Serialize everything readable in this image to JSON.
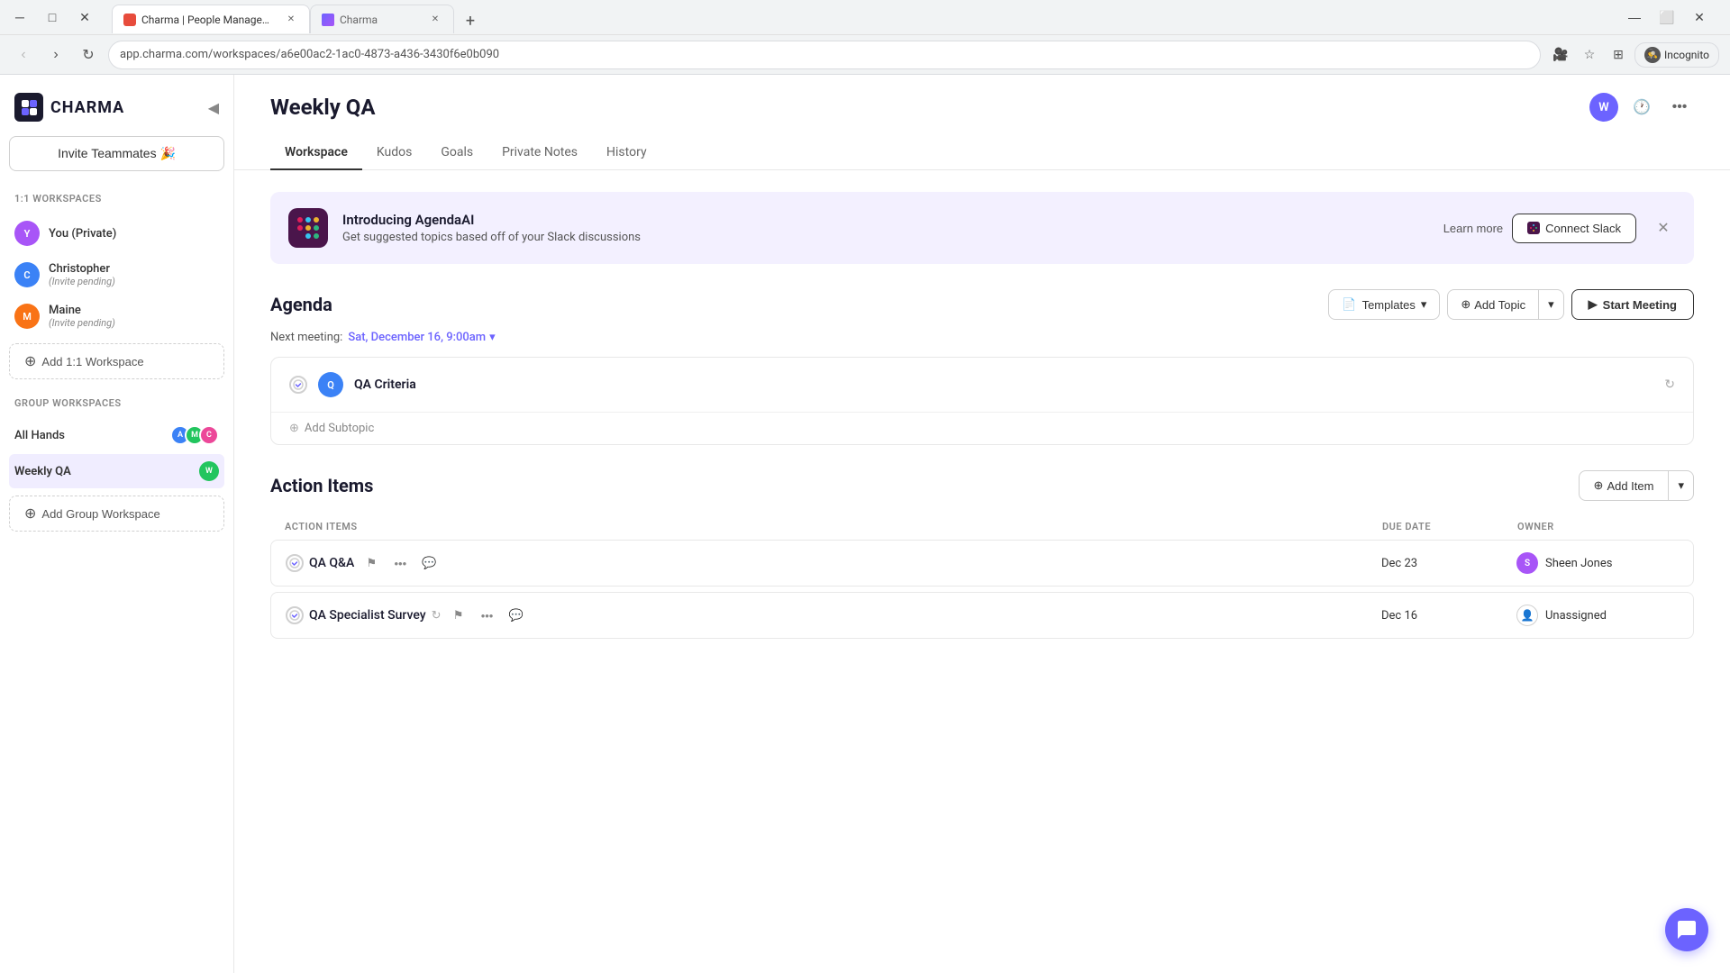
{
  "browser": {
    "tabs": [
      {
        "id": "tab1",
        "favicon_color": "#e74c3c",
        "title": "Charma | People Management S...",
        "active": true
      },
      {
        "id": "tab2",
        "favicon_color": "#6c63ff",
        "title": "Charma",
        "active": false
      }
    ],
    "new_tab_label": "+",
    "address": "app.charma.com/workspaces/a6e00ac2-1ac0-4873-a436-3430f6e0b090",
    "incognito_label": "Incognito"
  },
  "sidebar": {
    "logo_text": "CHARMA",
    "invite_btn": "Invite Teammates 🎉",
    "section_1_1": "1:1 Workspaces",
    "items_1_1": [
      {
        "name": "You (Private)",
        "sub": "",
        "avatar_text": "Y",
        "avatar_color": "#6c63ff"
      },
      {
        "name": "Christopher",
        "sub": "(Invite pending)",
        "avatar_text": "C",
        "avatar_color": "#3b82f6"
      },
      {
        "name": "Maine",
        "sub": "(Invite pending)",
        "avatar_text": "M",
        "avatar_color": "#f97316"
      }
    ],
    "add_1_1_label": "Add 1:1 Workspace",
    "section_group": "Group Workspaces",
    "group_items": [
      {
        "name": "All Hands",
        "avatars": [
          "#3b82f6",
          "#22c55e",
          "#ec4899"
        ],
        "avatar_texts": [
          "A",
          "M",
          "C"
        ]
      },
      {
        "name": "Weekly QA",
        "active": true,
        "avatar_text": "W",
        "avatar_color": "#22c55e"
      }
    ],
    "add_group_label": "Add Group Workspace"
  },
  "header": {
    "title": "Weekly QA",
    "tabs": [
      "Workspace",
      "Kudos",
      "Goals",
      "Private Notes",
      "History"
    ],
    "active_tab": "Workspace"
  },
  "banner": {
    "title": "Introducing AgendaAI",
    "subtitle": "Get suggested topics based off of your Slack discussions",
    "learn_more": "Learn more",
    "connect_slack": "Connect Slack"
  },
  "agenda": {
    "title": "Agenda",
    "templates_label": "Templates",
    "add_topic_label": "Add Topic",
    "start_meeting_label": "Start Meeting",
    "next_meeting_label": "Next meeting:",
    "next_meeting_date": "Sat, December 16, 9:00am",
    "items": [
      {
        "id": 1,
        "title": "QA Criteria",
        "has_sync": true
      }
    ],
    "add_subtopic_label": "Add Subtopic"
  },
  "action_items": {
    "title": "Action Items",
    "add_item_label": "Add Item",
    "col_action_items": "ACTION ITEMS",
    "col_due_date": "DUE DATE",
    "col_owner": "OWNER",
    "items": [
      {
        "id": 1,
        "name": "QA Q&A",
        "due_date": "Dec 23",
        "owner_name": "Sheen Jones",
        "owner_avatar_text": "S",
        "owner_avatar_color": "#6c63ff",
        "has_owner_photo": true
      },
      {
        "id": 2,
        "name": "QA Specialist Survey",
        "due_date": "Dec 16",
        "owner_name": "Unassigned",
        "has_sync": true
      }
    ]
  },
  "icons": {
    "check_circle": "✓",
    "sync": "↻",
    "plus": "+",
    "chevron_down": "▾",
    "flag": "⚑",
    "ellipsis": "•••",
    "comment": "💬",
    "close": "✕",
    "camera": "📷",
    "clock": "🕐",
    "dots": "⋯",
    "slack_icon": "💬",
    "collapse": "◀",
    "chat_bubble": "💬",
    "person": "👤"
  }
}
